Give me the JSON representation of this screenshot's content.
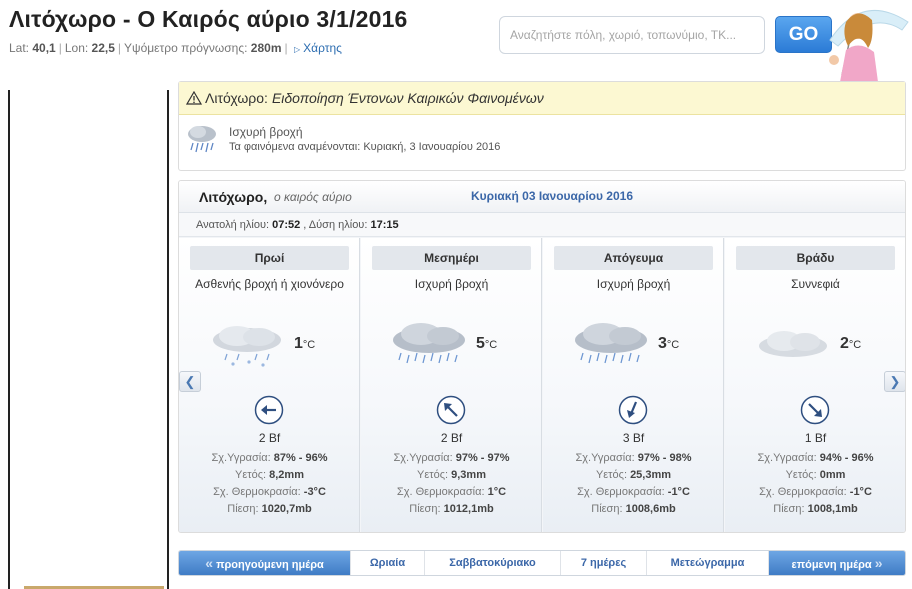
{
  "header": {
    "title": "Λιτόχωρο - Ο Καιρός αύριο 3/1/2016",
    "lat_label": "Lat:",
    "lat": "40,1",
    "lon_label": "Lon:",
    "lon": "22,5",
    "altitude_label": "Υψόμετρο πρόγνωσης:",
    "altitude": "280m",
    "map_link": "Χάρτης"
  },
  "search": {
    "placeholder": "Αναζητήστε πόλη, χωριό, τοπωνύμιο, ΤΚ...",
    "go_label": "GO"
  },
  "warning": {
    "place": "Λιτόχωρο:",
    "headline": "Ειδοποίηση Έντονων Καιρικών Φαινομένων",
    "type": "Ισχυρή βροχή",
    "expected_label": "Τα φαινόμενα αναμένονται:",
    "expected_date": "Κυριακή, 3 Ιανουαρίου 2016"
  },
  "forecast": {
    "place": "Λιτόχωρο,",
    "place_sub": "ο καιρός αύριο",
    "date": "Κυριακή 03 Ιανουαρίου 2016",
    "sunrise_label": "Ανατολή ηλίου:",
    "sunrise": "07:52",
    "sunset_label": ", Δύση ηλίου:",
    "sunset": "17:15",
    "humidity_label": "Σχ.Υγρασία:",
    "rain_label": "Υετός:",
    "feels_label": "Σχ. Θερμοκρασία:",
    "pressure_label": "Πίεση:",
    "periods": [
      {
        "label": "Πρωί",
        "desc": "Ασθενής βροχή ή χιονόνερο",
        "icon": "sleet-cloud-icon",
        "temp": "1",
        "unit": "°C",
        "wind": "2 Bf",
        "wind_dir": "arrow-left",
        "humidity": "87% - 96%",
        "rain": "8,2mm",
        "feels": "-3°C",
        "pressure": "1020,7mb"
      },
      {
        "label": "Μεσημέρι",
        "desc": "Ισχυρή βροχή",
        "icon": "heavy-rain-cloud-icon",
        "temp": "5",
        "unit": "°C",
        "wind": "2 Bf",
        "wind_dir": "arrow-up-left",
        "humidity": "97% - 97%",
        "rain": "9,3mm",
        "feels": "1°C",
        "pressure": "1012,1mb"
      },
      {
        "label": "Απόγευμα",
        "desc": "Ισχυρή βροχή",
        "icon": "heavy-rain-cloud-icon",
        "temp": "3",
        "unit": "°C",
        "wind": "3 Bf",
        "wind_dir": "arrow-down-left",
        "humidity": "97% - 98%",
        "rain": "25,3mm",
        "feels": "-1°C",
        "pressure": "1008,6mb"
      },
      {
        "label": "Βράδυ",
        "desc": "Συννεφιά",
        "icon": "cloudy-icon",
        "temp": "2",
        "unit": "°C",
        "wind": "1 Bf",
        "wind_dir": "arrow-down-right",
        "humidity": "94% - 96%",
        "rain": "0mm",
        "feels": "-1°C",
        "pressure": "1008,1mb"
      }
    ]
  },
  "bottom_nav": {
    "prev": "προηγούμενη ημέρα",
    "hourly": "Ωριαία",
    "weekend": "Σαββατοκύριακο",
    "seven_days": "7 ημέρες",
    "meteogram": "Μετεώγραμμα",
    "next": "επόμενη ημέρα"
  },
  "colors": {
    "accent_blue": "#3b67a8",
    "warning_bg": "#fcf8d2",
    "go_button": "#2b7bd6"
  }
}
